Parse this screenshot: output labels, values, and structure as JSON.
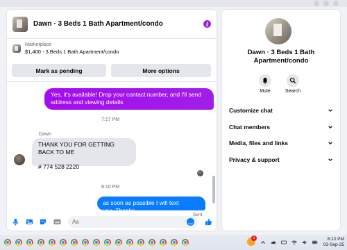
{
  "chat": {
    "header_title": "Dawn · 3 Beds 1 Bath Apartment/condo",
    "marketplace_label": "Marketplace",
    "listing_detail": "$1,400 - 3 Beds 1 Bath Apartment/condo",
    "mark_pending_label": "Mark as pending",
    "more_options_label": "More options",
    "messages": {
      "outgoing_1": "Yes, it's available! Drop your contact number, and I'll send address and viewing details",
      "timestamp_1": "7:17 PM",
      "sender_name": "Dawn",
      "incoming_line1": "THANK YOU FOR GETTING BACK TO ME",
      "incoming_line2": "# 774 528 2220",
      "timestamp_2": "8:10 PM",
      "outgoing_2": "as soon as possible I will text you..Thanks",
      "sent_label": "Sent"
    },
    "composer_placeholder": "Aa"
  },
  "info_panel": {
    "title": "Dawn · 3 Beds 1 Bath Apartment/condo",
    "mute_label": "Mute",
    "search_label": "Search",
    "sections": [
      "Customize chat",
      "Chat members",
      "Media, files and links",
      "Privacy & support"
    ]
  },
  "taskbar": {
    "notification_count": "2",
    "time": "8:10 PM",
    "date": "03-Sep-25"
  },
  "colors": {
    "purple_bubble": "#a20df0",
    "blue_bubble": "#0a7cff",
    "accent_purple": "#9b2ad6"
  }
}
